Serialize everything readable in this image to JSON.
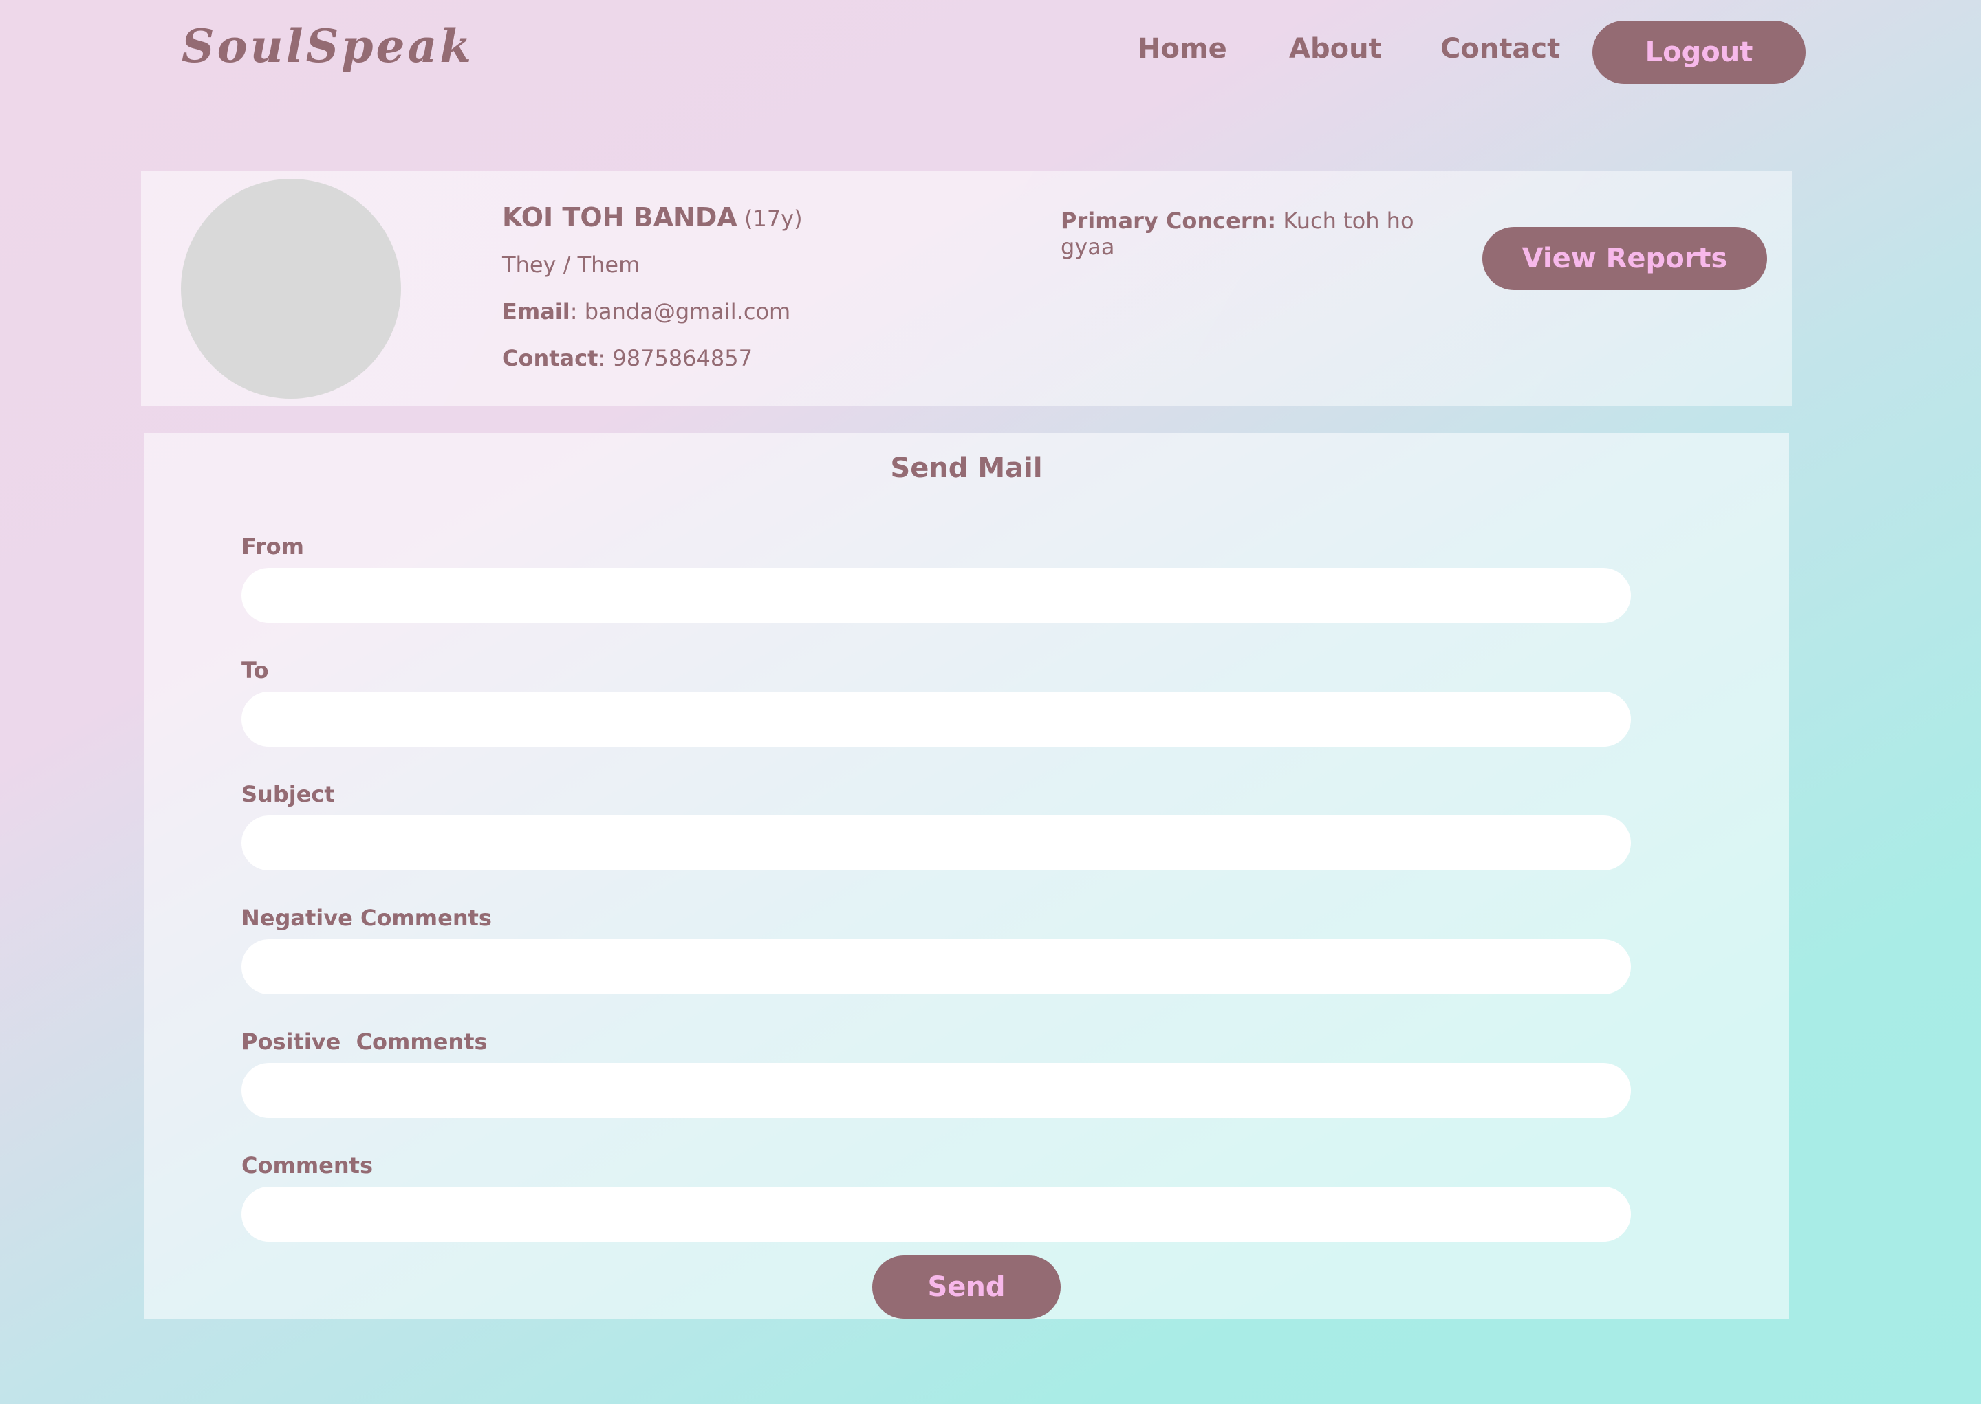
{
  "header": {
    "logo": "SoulSpeak",
    "nav": {
      "home": "Home",
      "about": "About",
      "contact": "Contact"
    },
    "logout_label": "Logout"
  },
  "profile": {
    "name": "KOI TOH BANDA",
    "age": "(17y)",
    "pronouns": "They / Them",
    "email_label": "Email",
    "email": ": banda@gmail.com",
    "contact_label": "Contact",
    "contact": ": 9875864857",
    "concern_label": "Primary Concern:",
    "concern_line1": " Kuch toh ho",
    "concern_line2": "gyaa",
    "view_reports_label": "View Reports"
  },
  "mail_form": {
    "title": "Send Mail",
    "fields": {
      "from": {
        "label": "From",
        "value": ""
      },
      "to": {
        "label": "To",
        "value": ""
      },
      "subject": {
        "label": "Subject",
        "value": ""
      },
      "negative": {
        "label": "Negative Comments",
        "value": ""
      },
      "positive": {
        "label": "Positive  Comments",
        "value": ""
      },
      "comments": {
        "label": "Comments",
        "value": ""
      }
    },
    "send_label": "Send"
  },
  "colors": {
    "accent": "#946b73",
    "button_text": "#f7b8ea",
    "avatar": "#d9d9d9"
  }
}
